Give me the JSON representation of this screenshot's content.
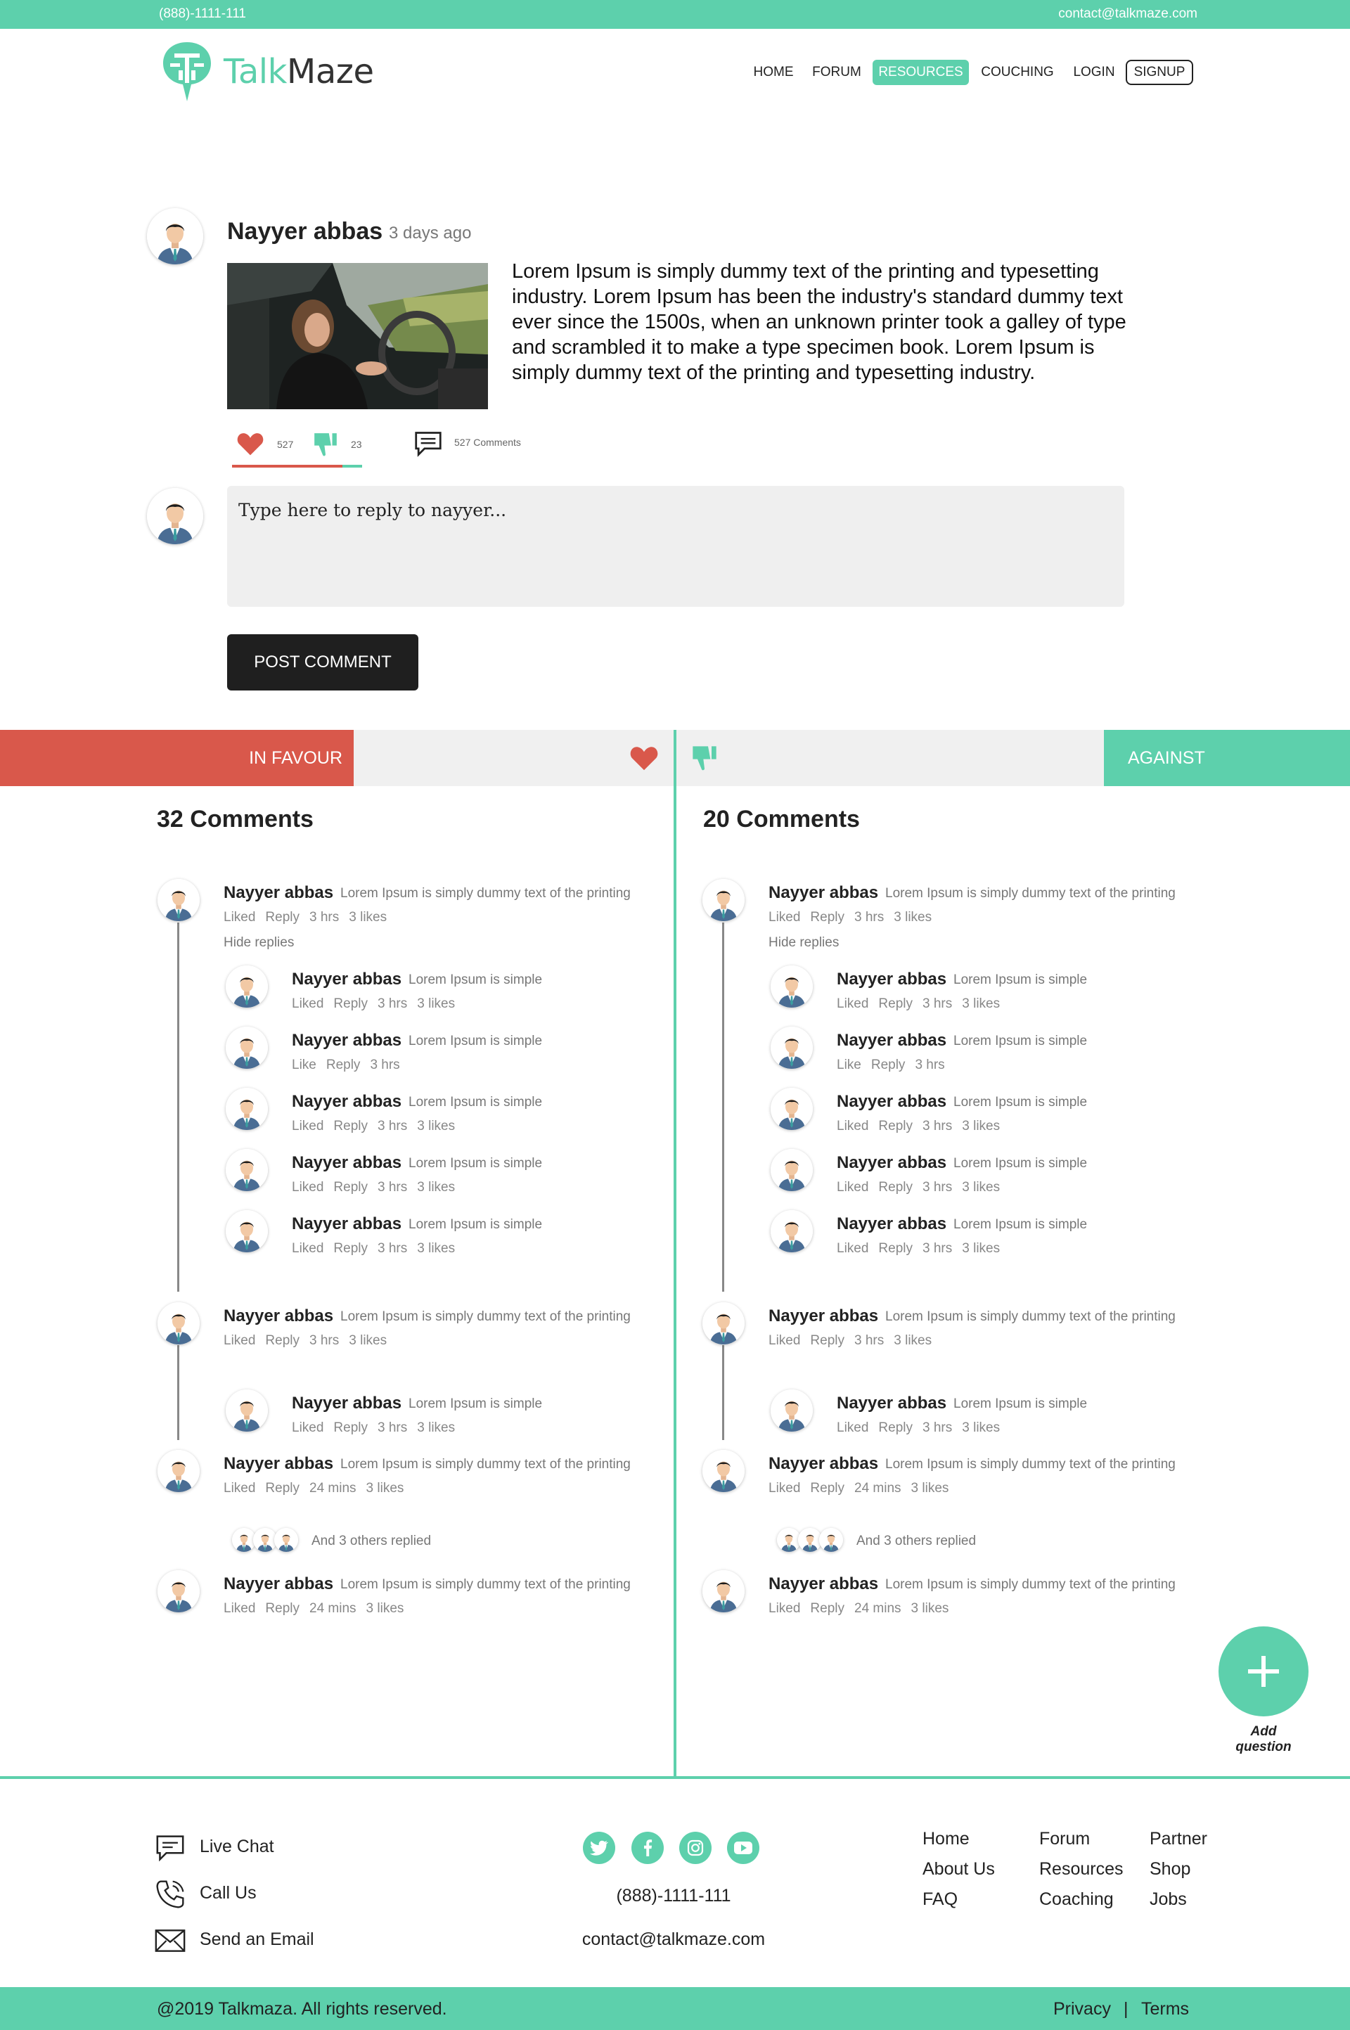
{
  "topbar": {
    "phone": "(888)-1111-111",
    "email": "contact@talkmaze.com"
  },
  "brand": {
    "talk": "Talk",
    "maze": "Maze"
  },
  "nav": {
    "home": "HOME",
    "forum": "FORUM",
    "resources": "RESOURCES",
    "couching": "COUCHING",
    "login": "LOGIN",
    "signup": "SIGNUP"
  },
  "post": {
    "author": "Nayyer abbas",
    "time": "3 days ago",
    "text": "Lorem Ipsum is simply dummy text of the printing and typesetting industry. Lorem Ipsum has been the industry's standard dummy text ever since the 1500s, when an unknown printer took a galley of type and scrambled it to make a type specimen book. Lorem Ipsum is simply dummy text of the printing and typesetting industry.",
    "likes": "527",
    "dislikes": "23",
    "comments": "527 Comments"
  },
  "reply": {
    "placeholder": "Type here to reply to nayyer...",
    "button": "POST COMMENT"
  },
  "sections": {
    "favour": "IN FAVOUR",
    "against": "AGAINST"
  },
  "favour_col": {
    "title": "32 Comments",
    "comments": [
      {
        "name": "Nayyer abbas",
        "text": "Lorem Ipsum is simply dummy text of the printing",
        "m1": "Liked",
        "m2": "Reply",
        "m3": "3 hrs",
        "m4": "3 likes"
      },
      {
        "name": "Nayyer abbas",
        "text": "Lorem Ipsum is simply dummy text of the printing",
        "m1": "Liked",
        "m2": "Reply",
        "m3": "3 hrs",
        "m4": "3 likes"
      },
      {
        "name": "Nayyer abbas",
        "text": "Lorem Ipsum is simply dummy text of the printing",
        "m1": "Liked",
        "m2": "Reply",
        "m3": "24 mins",
        "m4": "3 likes"
      },
      {
        "name": "Nayyer abbas",
        "text": "Lorem Ipsum is simply dummy text of the printing",
        "m1": "Liked",
        "m2": "Reply",
        "m3": "24 mins",
        "m4": "3 likes"
      }
    ],
    "hide_replies": "Hide replies",
    "replies": [
      {
        "name": "Nayyer abbas",
        "text": "Lorem Ipsum is simple",
        "m1": "Liked",
        "m2": "Reply",
        "m3": "3 hrs",
        "m4": "3 likes"
      },
      {
        "name": "Nayyer abbas",
        "text": "Lorem Ipsum is simple",
        "m1": "Like",
        "m2": "Reply",
        "m3": "3 hrs",
        "m4": ""
      },
      {
        "name": "Nayyer abbas",
        "text": "Lorem Ipsum is simple",
        "m1": "Liked",
        "m2": "Reply",
        "m3": "3 hrs",
        "m4": "3 likes"
      },
      {
        "name": "Nayyer abbas",
        "text": "Lorem Ipsum is simple",
        "m1": "Liked",
        "m2": "Reply",
        "m3": "3 hrs",
        "m4": "3 likes"
      },
      {
        "name": "Nayyer abbas",
        "text": "Lorem Ipsum is simple",
        "m1": "Liked",
        "m2": "Reply",
        "m3": "3 hrs",
        "m4": "3 likes"
      },
      {
        "name": "Nayyer abbas",
        "text": "Lorem Ipsum is simple",
        "m1": "Liked",
        "m2": "Reply",
        "m3": "3 hrs",
        "m4": "3 likes"
      }
    ],
    "others": "And 3 others replied"
  },
  "against_col": {
    "title": "20 Comments",
    "comments": [
      {
        "name": "Nayyer abbas",
        "text": "Lorem Ipsum is simply dummy text of the printing",
        "m1": "Liked",
        "m2": "Reply",
        "m3": "3 hrs",
        "m4": "3 likes"
      },
      {
        "name": "Nayyer abbas",
        "text": "Lorem Ipsum is simply dummy text of the printing",
        "m1": "Liked",
        "m2": "Reply",
        "m3": "3 hrs",
        "m4": "3 likes"
      },
      {
        "name": "Nayyer abbas",
        "text": "Lorem Ipsum is simply dummy text of the printing",
        "m1": "Liked",
        "m2": "Reply",
        "m3": "24 mins",
        "m4": "3 likes"
      },
      {
        "name": "Nayyer abbas",
        "text": "Lorem Ipsum is simply dummy text of the printing",
        "m1": "Liked",
        "m2": "Reply",
        "m3": "24 mins",
        "m4": "3 likes"
      }
    ],
    "hide_replies": "Hide replies",
    "replies": [
      {
        "name": "Nayyer abbas",
        "text": "Lorem Ipsum is simple",
        "m1": "Liked",
        "m2": "Reply",
        "m3": "3 hrs",
        "m4": "3 likes"
      },
      {
        "name": "Nayyer abbas",
        "text": "Lorem Ipsum is simple",
        "m1": "Like",
        "m2": "Reply",
        "m3": "3 hrs",
        "m4": ""
      },
      {
        "name": "Nayyer abbas",
        "text": "Lorem Ipsum is simple",
        "m1": "Liked",
        "m2": "Reply",
        "m3": "3 hrs",
        "m4": "3 likes"
      },
      {
        "name": "Nayyer abbas",
        "text": "Lorem Ipsum is simple",
        "m1": "Liked",
        "m2": "Reply",
        "m3": "3 hrs",
        "m4": "3 likes"
      },
      {
        "name": "Nayyer abbas",
        "text": "Lorem Ipsum is simple",
        "m1": "Liked",
        "m2": "Reply",
        "m3": "3 hrs",
        "m4": "3 likes"
      },
      {
        "name": "Nayyer abbas",
        "text": "Lorem Ipsum is simple",
        "m1": "Liked",
        "m2": "Reply",
        "m3": "3 hrs",
        "m4": "3 likes"
      }
    ],
    "others": "And 3 others replied"
  },
  "fab": {
    "label": "Add question"
  },
  "footer": {
    "live_chat": "Live Chat",
    "call_us": "Call Us",
    "send_email": "Send an Email",
    "phone": "(888)-1111-111",
    "email": "contact@talkmaze.com",
    "links": [
      "Home",
      "About Us",
      "FAQ",
      "Forum",
      "Resources",
      "Coaching",
      "Partner",
      "Shop",
      "Jobs"
    ],
    "copyright": "@2019 Talkmaza. All rights reserved.",
    "privacy": "Privacy",
    "separator": "|",
    "terms": "Terms"
  },
  "colors": {
    "accent": "#5dd0ac",
    "favour": "#d9584b",
    "dark": "#1f1f1f"
  }
}
